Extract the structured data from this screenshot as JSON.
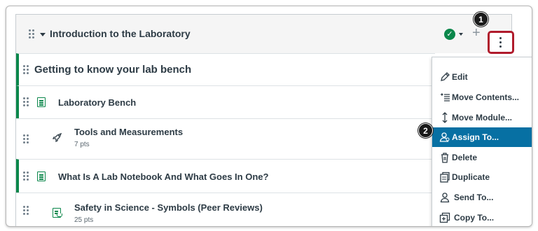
{
  "module": {
    "title": "Introduction to the Laboratory",
    "published_icon": "checkmark-icon",
    "add_icon": "plus-icon",
    "menu_icon": "kebab-icon"
  },
  "callouts": {
    "first": "1",
    "second": "2"
  },
  "items": [
    {
      "title": "Getting to know your lab bench",
      "type": "subheader",
      "published": true,
      "points": ""
    },
    {
      "title": "Laboratory Bench",
      "type": "page",
      "published": true,
      "points": ""
    },
    {
      "title": "Tools and Measurements",
      "type": "quiz",
      "published": false,
      "points": "7 pts"
    },
    {
      "title": "What Is A Lab Notebook And What Goes In One?",
      "type": "page",
      "published": true,
      "points": ""
    },
    {
      "title": "Safety in Science - Symbols (Peer Reviews)",
      "type": "peer-review",
      "published": false,
      "points": "25 pts"
    }
  ],
  "menu": [
    {
      "label": "Edit",
      "icon": "pencil-icon",
      "active": false
    },
    {
      "label": "Move Contents...",
      "icon": "move-contents-icon",
      "active": false
    },
    {
      "label": "Move Module...",
      "icon": "move-module-icon",
      "active": false
    },
    {
      "label": "Assign To...",
      "icon": "assign-icon",
      "active": true
    },
    {
      "label": "Delete",
      "icon": "trash-icon",
      "active": false
    },
    {
      "label": "Duplicate",
      "icon": "duplicate-icon",
      "active": false
    },
    {
      "label": "Send To...",
      "icon": "send-icon",
      "active": false
    },
    {
      "label": "Copy To...",
      "icon": "copy-icon",
      "active": false
    }
  ],
  "colors": {
    "published_green": "#0b874b",
    "highlight_red": "#b01b2c",
    "active_blue": "#0770a3",
    "text": "#2d3b45"
  }
}
